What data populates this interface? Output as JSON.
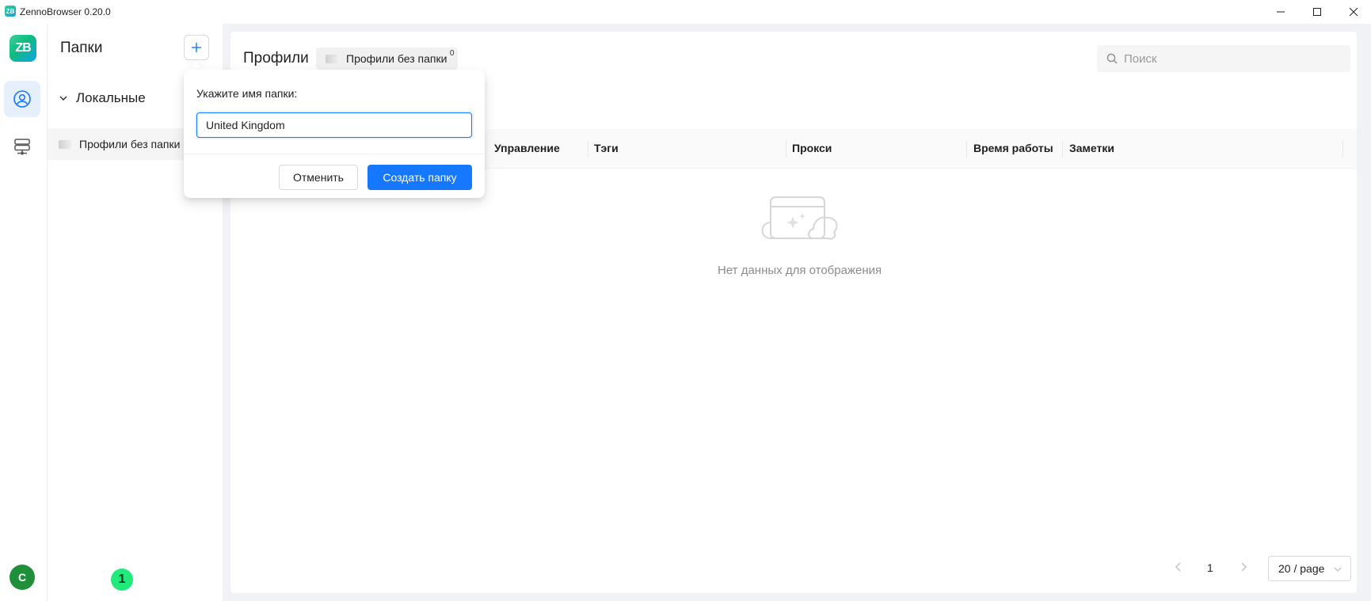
{
  "window": {
    "title": "ZennoBrowser 0.20.0",
    "logo_text": "ZB"
  },
  "rail": {
    "logo_text": "ZB",
    "avatar_initial": "C",
    "icons": [
      "user-circle-icon",
      "server-icon"
    ]
  },
  "folders": {
    "title": "Папки",
    "group_label": "Локальные",
    "items": [
      {
        "label": "Профили без папки"
      }
    ],
    "badge_number": "1"
  },
  "main": {
    "title": "Профили",
    "current_folder": {
      "label": "Профили без папки",
      "count": "0"
    },
    "search": {
      "placeholder": "Поиск",
      "value": ""
    },
    "table": {
      "columns": [
        "Управление",
        "Тэги",
        "Прокси",
        "Время работы",
        "Заметки"
      ]
    },
    "empty_text": "Нет данных для отображения",
    "pagination": {
      "current_page": "1",
      "page_size": "20 / page"
    }
  },
  "popover": {
    "label": "Укажите имя папки:",
    "input_value": "United Kingdom",
    "cancel_label": "Отменить",
    "create_label": "Создать папку"
  },
  "colors": {
    "primary": "#1677ff",
    "rail_active_bg": "#e6f0fc",
    "badge_green": "#1fea7a",
    "avatar_green": "#1f8f3a"
  }
}
